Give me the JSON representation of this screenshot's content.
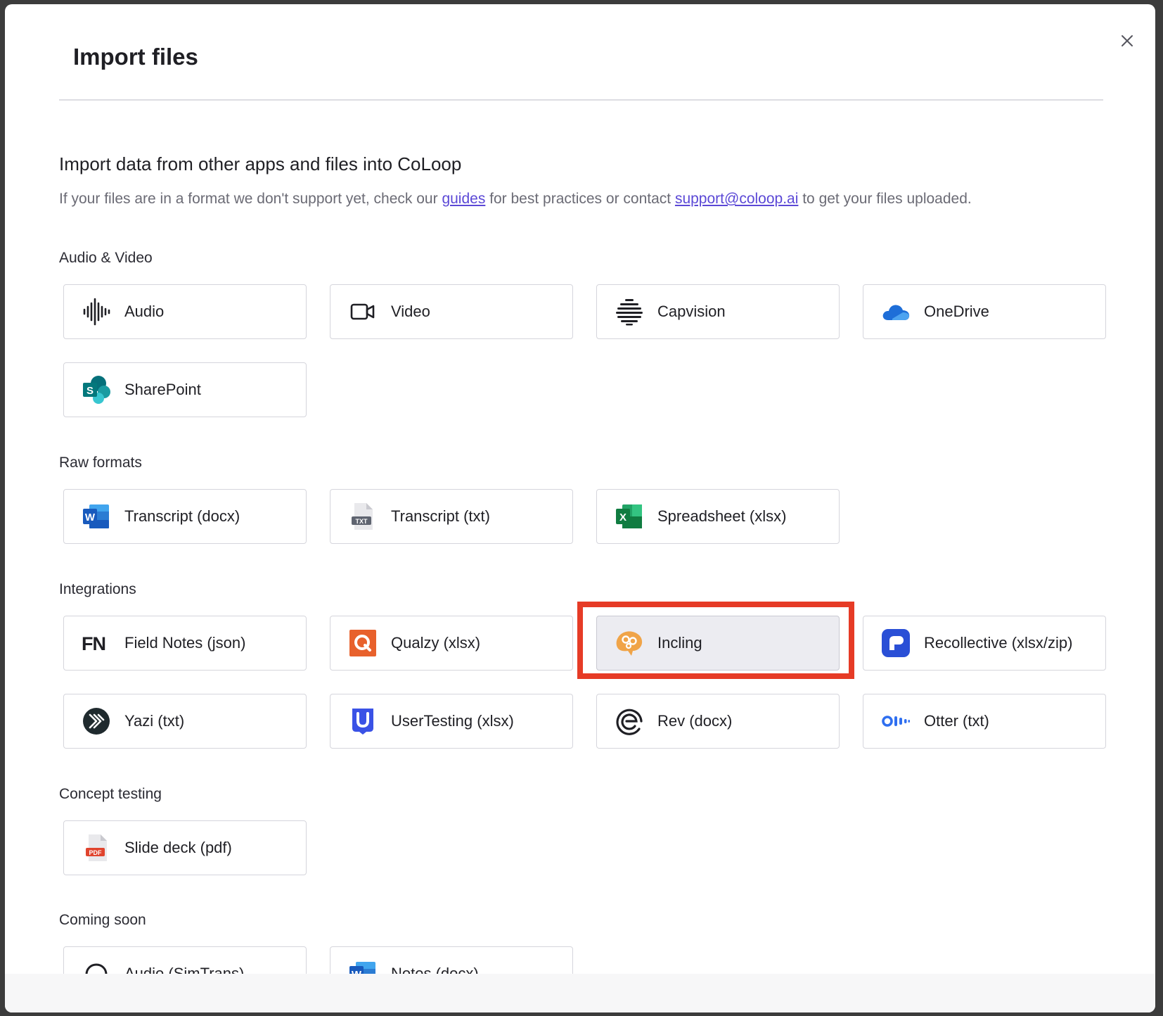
{
  "modal": {
    "title": "Import files",
    "subtitle": "Import data from other apps and files into CoLoop",
    "description": {
      "part1": "If your files are in a format we don't support yet, check our ",
      "link_guides": "guides",
      "part2": " for best practices or contact ",
      "link_support": "support@coloop.ai",
      "part3": " to get your files uploaded."
    }
  },
  "sections": {
    "audio_video": {
      "label": "Audio & Video",
      "items": [
        {
          "label": "Audio",
          "icon": "audio-waveform-icon"
        },
        {
          "label": "Video",
          "icon": "video-camera-icon"
        },
        {
          "label": "Capvision",
          "icon": "capvision-logo-icon"
        },
        {
          "label": "OneDrive",
          "icon": "onedrive-cloud-icon"
        },
        {
          "label": "SharePoint",
          "icon": "sharepoint-logo-icon"
        }
      ]
    },
    "raw_formats": {
      "label": "Raw formats",
      "items": [
        {
          "label": "Transcript (docx)",
          "icon": "word-doc-icon"
        },
        {
          "label": "Transcript (txt)",
          "icon": "txt-file-icon"
        },
        {
          "label": "Spreadsheet (xlsx)",
          "icon": "excel-icon"
        }
      ]
    },
    "integrations": {
      "label": "Integrations",
      "items": [
        {
          "label": "Field Notes (json)",
          "icon": "fieldnotes-logo-icon"
        },
        {
          "label": "Qualzy (xlsx)",
          "icon": "qualzy-logo-icon"
        },
        {
          "label": "Incling",
          "icon": "incling-logo-icon"
        },
        {
          "label": "Recollective (xlsx/zip)",
          "icon": "recollective-logo-icon"
        },
        {
          "label": "Yazi (txt)",
          "icon": "yazi-logo-icon"
        },
        {
          "label": "UserTesting (xlsx)",
          "icon": "usertesting-logo-icon"
        },
        {
          "label": "Rev (docx)",
          "icon": "rev-logo-icon"
        },
        {
          "label": "Otter (txt)",
          "icon": "otter-logo-icon"
        }
      ]
    },
    "concept_testing": {
      "label": "Concept testing",
      "items": [
        {
          "label": "Slide deck (pdf)",
          "icon": "pdf-file-icon"
        }
      ]
    },
    "coming_soon": {
      "label": "Coming soon",
      "items": [
        {
          "label": "Audio (SimTrans)",
          "icon": "headphones-icon"
        },
        {
          "label": "Notes (docx)",
          "icon": "word-doc-icon"
        }
      ]
    }
  },
  "colors": {
    "link": "#5b48d6",
    "highlight_outline": "#e63b26",
    "selected_card_bg": "#ececf1"
  }
}
